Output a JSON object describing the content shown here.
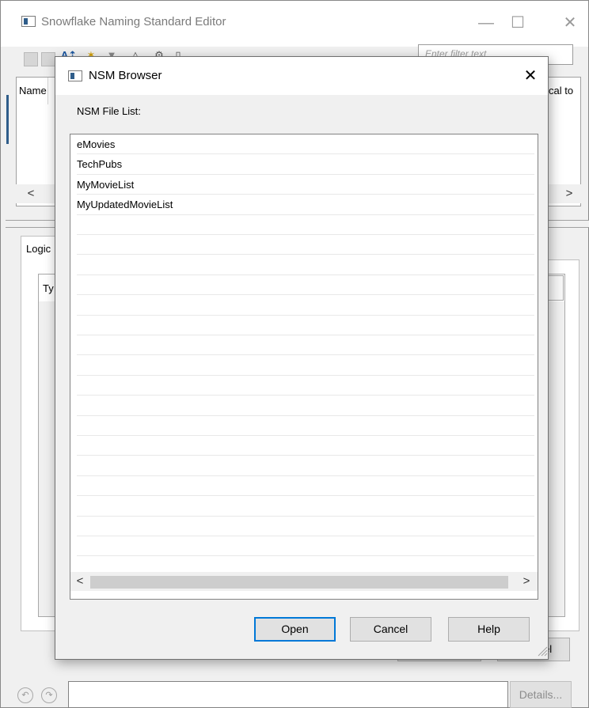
{
  "main_window": {
    "title": "Snowflake Naming Standard Editor",
    "controls": {
      "minimize": "—",
      "maximize": "☐",
      "close": "✕"
    },
    "filter_placeholder": "Enter filter text",
    "name_panel": {
      "columns": [
        "Name",
        "cal to"
      ],
      "scroll_left": "<",
      "scroll_right": ">"
    },
    "tabs": [
      "Logic"
    ],
    "inner_grid_header": "Ty",
    "buttons": {
      "partial_right": "el"
    },
    "status": {
      "text": "",
      "details_label": "Details..."
    },
    "icons": [
      "first-record-icon",
      "previous-record-icon",
      "add-name-icon",
      "new-item-icon",
      "filter-icon",
      "import-icon",
      "settings-icon",
      "document-icon",
      "undo-icon",
      "redo-icon"
    ]
  },
  "dialog": {
    "title": "NSM Browser",
    "close": "✕",
    "list_label": "NSM File List:",
    "files": [
      "eMovies",
      "TechPubs",
      "MyMovieList",
      "MyUpdatedMovieList"
    ],
    "scroll_left": "<",
    "scroll_right": ">",
    "buttons": {
      "open": "Open",
      "cancel": "Cancel",
      "help": "Help"
    },
    "focus_color": "#0078d7"
  }
}
